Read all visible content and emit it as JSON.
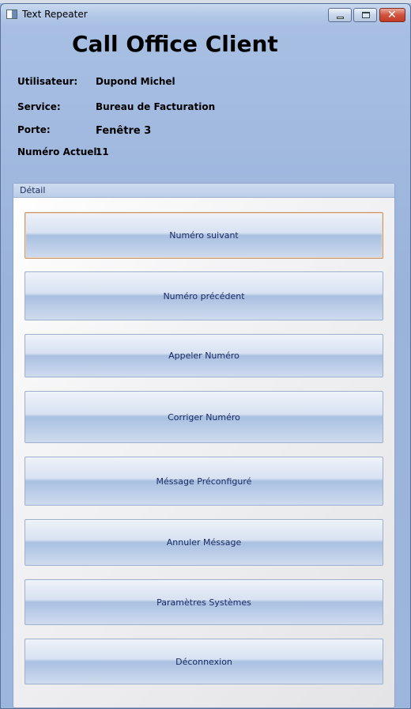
{
  "window": {
    "title": "Text Repeater",
    "controls": {
      "minimize_icon": "minimize-icon",
      "maximize_icon": "maximize-icon",
      "close_icon": "close-icon"
    }
  },
  "header": {
    "app_title": "Call Office Client"
  },
  "info": {
    "user_label": "Utilisateur:",
    "user_value": "Dupond Michel",
    "service_label": "Service:",
    "service_value": "Bureau de Facturation",
    "porte_label": "Porte:",
    "porte_value": "Fenêtre 3",
    "numero_label": "Numéro Actuel:",
    "numero_value": "11"
  },
  "detail": {
    "header": "Détail",
    "buttons": [
      {
        "label": "Numéro suivant"
      },
      {
        "label": "Numéro précédent"
      },
      {
        "label": "Appeler Numéro"
      },
      {
        "label": "Corriger Numéro"
      },
      {
        "label": "Méssage Préconfiguré"
      },
      {
        "label": "Annuler Méssage"
      },
      {
        "label": "Paramètres Systèmes"
      },
      {
        "label": "Déconnexion"
      }
    ]
  }
}
